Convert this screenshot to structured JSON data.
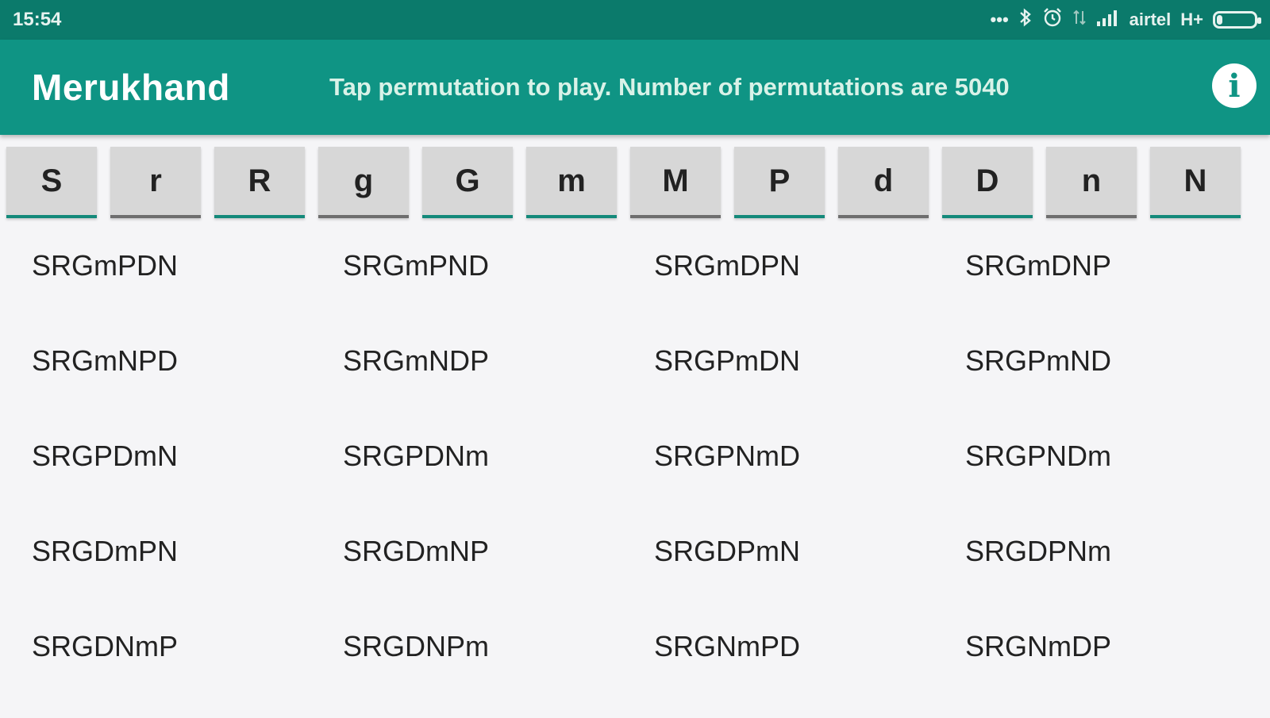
{
  "status_bar": {
    "time": "15:54",
    "carrier": "airtel",
    "network": "H+",
    "icons": [
      "more-dots-icon",
      "bluetooth-icon",
      "alarm-icon",
      "data-arrows-icon",
      "signal-icon",
      "battery-icon"
    ],
    "battery_level": 0.15
  },
  "app_bar": {
    "title": "Merukhand",
    "subtitle": "Tap permutation to play. Number of permutations are 5040",
    "info_icon": "i"
  },
  "notes": [
    {
      "label": "S",
      "selected": true
    },
    {
      "label": "r",
      "selected": false
    },
    {
      "label": "R",
      "selected": true
    },
    {
      "label": "g",
      "selected": false
    },
    {
      "label": "G",
      "selected": true
    },
    {
      "label": "m",
      "selected": true
    },
    {
      "label": "M",
      "selected": false
    },
    {
      "label": "P",
      "selected": true
    },
    {
      "label": "d",
      "selected": false
    },
    {
      "label": "D",
      "selected": true
    },
    {
      "label": "n",
      "selected": false
    },
    {
      "label": "N",
      "selected": true
    }
  ],
  "permutations": [
    [
      "SRGmPDN",
      "SRGmPND",
      "SRGmDPN",
      "SRGmDNP"
    ],
    [
      "SRGmNPD",
      "SRGmNDP",
      "SRGPmDN",
      "SRGPmND"
    ],
    [
      "SRGPDmN",
      "SRGPDNm",
      "SRGPNmD",
      "SRGPNDm"
    ],
    [
      "SRGDmPN",
      "SRGDmNP",
      "SRGDPmN",
      "SRGDPNm"
    ],
    [
      "SRGDNmP",
      "SRGDNPm",
      "SRGNmPD",
      "SRGNmDP"
    ]
  ],
  "colors": {
    "status_bar": "#0b7a6b",
    "app_bar": "#0f9484",
    "selected_underline": "#14897a",
    "unselected_underline": "#6e6e6e"
  }
}
